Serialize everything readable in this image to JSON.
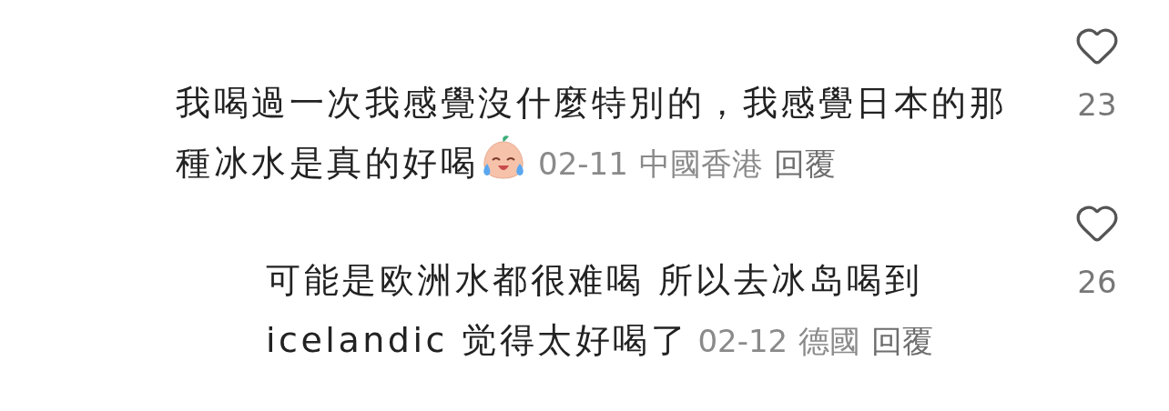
{
  "comments": [
    {
      "text": "我喝過一次我感覺沒什麼特別的，我感覺日本的那種冰水是真的好喝",
      "emoji": true,
      "date": "02-11",
      "location": "中國香港",
      "reply": "回覆",
      "likes": "23",
      "liked": false,
      "kind": "comment"
    },
    {
      "text": "可能是欧洲水都很难喝 所以去冰岛喝到icelandic 觉得太好喝了",
      "emoji": false,
      "date": "02-12",
      "location": "德國",
      "reply": "回覆",
      "likes": "26",
      "liked": false,
      "kind": "reply"
    }
  ]
}
